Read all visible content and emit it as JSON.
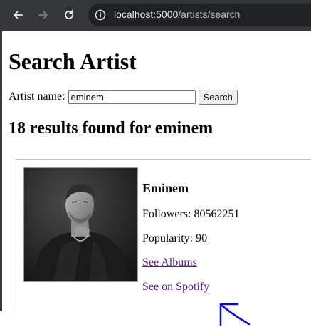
{
  "browser": {
    "url_host": "localhost:5000",
    "url_path": "/artists/search"
  },
  "page": {
    "title": "Search Artist",
    "search": {
      "label": "Artist name:",
      "value": "eminem",
      "button_label": "Search"
    },
    "results_heading": "18 results found for eminem",
    "results": [
      {
        "name": "Eminem",
        "followers_label": "Followers: 80562251",
        "popularity_label": "Popularity: 90",
        "albums_link": "See Albums",
        "spotify_link": "See on Spotify"
      }
    ]
  },
  "colors": {
    "toolbar": "#35363a",
    "omnibox": "#202124",
    "visited_link": "#551a8b",
    "cursor_annotation": "#0000ff"
  }
}
